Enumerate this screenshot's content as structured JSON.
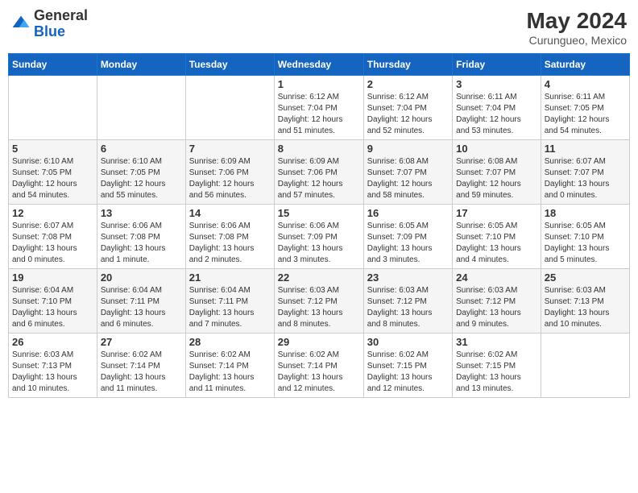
{
  "header": {
    "logo_general": "General",
    "logo_blue": "Blue",
    "month_year": "May 2024",
    "location": "Curungueo, Mexico"
  },
  "days_of_week": [
    "Sunday",
    "Monday",
    "Tuesday",
    "Wednesday",
    "Thursday",
    "Friday",
    "Saturday"
  ],
  "weeks": [
    [
      {
        "day": "",
        "info": ""
      },
      {
        "day": "",
        "info": ""
      },
      {
        "day": "",
        "info": ""
      },
      {
        "day": "1",
        "info": "Sunrise: 6:12 AM\nSunset: 7:04 PM\nDaylight: 12 hours\nand 51 minutes."
      },
      {
        "day": "2",
        "info": "Sunrise: 6:12 AM\nSunset: 7:04 PM\nDaylight: 12 hours\nand 52 minutes."
      },
      {
        "day": "3",
        "info": "Sunrise: 6:11 AM\nSunset: 7:04 PM\nDaylight: 12 hours\nand 53 minutes."
      },
      {
        "day": "4",
        "info": "Sunrise: 6:11 AM\nSunset: 7:05 PM\nDaylight: 12 hours\nand 54 minutes."
      }
    ],
    [
      {
        "day": "5",
        "info": "Sunrise: 6:10 AM\nSunset: 7:05 PM\nDaylight: 12 hours\nand 54 minutes."
      },
      {
        "day": "6",
        "info": "Sunrise: 6:10 AM\nSunset: 7:05 PM\nDaylight: 12 hours\nand 55 minutes."
      },
      {
        "day": "7",
        "info": "Sunrise: 6:09 AM\nSunset: 7:06 PM\nDaylight: 12 hours\nand 56 minutes."
      },
      {
        "day": "8",
        "info": "Sunrise: 6:09 AM\nSunset: 7:06 PM\nDaylight: 12 hours\nand 57 minutes."
      },
      {
        "day": "9",
        "info": "Sunrise: 6:08 AM\nSunset: 7:07 PM\nDaylight: 12 hours\nand 58 minutes."
      },
      {
        "day": "10",
        "info": "Sunrise: 6:08 AM\nSunset: 7:07 PM\nDaylight: 12 hours\nand 59 minutes."
      },
      {
        "day": "11",
        "info": "Sunrise: 6:07 AM\nSunset: 7:07 PM\nDaylight: 13 hours\nand 0 minutes."
      }
    ],
    [
      {
        "day": "12",
        "info": "Sunrise: 6:07 AM\nSunset: 7:08 PM\nDaylight: 13 hours\nand 0 minutes."
      },
      {
        "day": "13",
        "info": "Sunrise: 6:06 AM\nSunset: 7:08 PM\nDaylight: 13 hours\nand 1 minute."
      },
      {
        "day": "14",
        "info": "Sunrise: 6:06 AM\nSunset: 7:08 PM\nDaylight: 13 hours\nand 2 minutes."
      },
      {
        "day": "15",
        "info": "Sunrise: 6:06 AM\nSunset: 7:09 PM\nDaylight: 13 hours\nand 3 minutes."
      },
      {
        "day": "16",
        "info": "Sunrise: 6:05 AM\nSunset: 7:09 PM\nDaylight: 13 hours\nand 3 minutes."
      },
      {
        "day": "17",
        "info": "Sunrise: 6:05 AM\nSunset: 7:10 PM\nDaylight: 13 hours\nand 4 minutes."
      },
      {
        "day": "18",
        "info": "Sunrise: 6:05 AM\nSunset: 7:10 PM\nDaylight: 13 hours\nand 5 minutes."
      }
    ],
    [
      {
        "day": "19",
        "info": "Sunrise: 6:04 AM\nSunset: 7:10 PM\nDaylight: 13 hours\nand 6 minutes."
      },
      {
        "day": "20",
        "info": "Sunrise: 6:04 AM\nSunset: 7:11 PM\nDaylight: 13 hours\nand 6 minutes."
      },
      {
        "day": "21",
        "info": "Sunrise: 6:04 AM\nSunset: 7:11 PM\nDaylight: 13 hours\nand 7 minutes."
      },
      {
        "day": "22",
        "info": "Sunrise: 6:03 AM\nSunset: 7:12 PM\nDaylight: 13 hours\nand 8 minutes."
      },
      {
        "day": "23",
        "info": "Sunrise: 6:03 AM\nSunset: 7:12 PM\nDaylight: 13 hours\nand 8 minutes."
      },
      {
        "day": "24",
        "info": "Sunrise: 6:03 AM\nSunset: 7:12 PM\nDaylight: 13 hours\nand 9 minutes."
      },
      {
        "day": "25",
        "info": "Sunrise: 6:03 AM\nSunset: 7:13 PM\nDaylight: 13 hours\nand 10 minutes."
      }
    ],
    [
      {
        "day": "26",
        "info": "Sunrise: 6:03 AM\nSunset: 7:13 PM\nDaylight: 13 hours\nand 10 minutes."
      },
      {
        "day": "27",
        "info": "Sunrise: 6:02 AM\nSunset: 7:14 PM\nDaylight: 13 hours\nand 11 minutes."
      },
      {
        "day": "28",
        "info": "Sunrise: 6:02 AM\nSunset: 7:14 PM\nDaylight: 13 hours\nand 11 minutes."
      },
      {
        "day": "29",
        "info": "Sunrise: 6:02 AM\nSunset: 7:14 PM\nDaylight: 13 hours\nand 12 minutes."
      },
      {
        "day": "30",
        "info": "Sunrise: 6:02 AM\nSunset: 7:15 PM\nDaylight: 13 hours\nand 12 minutes."
      },
      {
        "day": "31",
        "info": "Sunrise: 6:02 AM\nSunset: 7:15 PM\nDaylight: 13 hours\nand 13 minutes."
      },
      {
        "day": "",
        "info": ""
      }
    ]
  ]
}
